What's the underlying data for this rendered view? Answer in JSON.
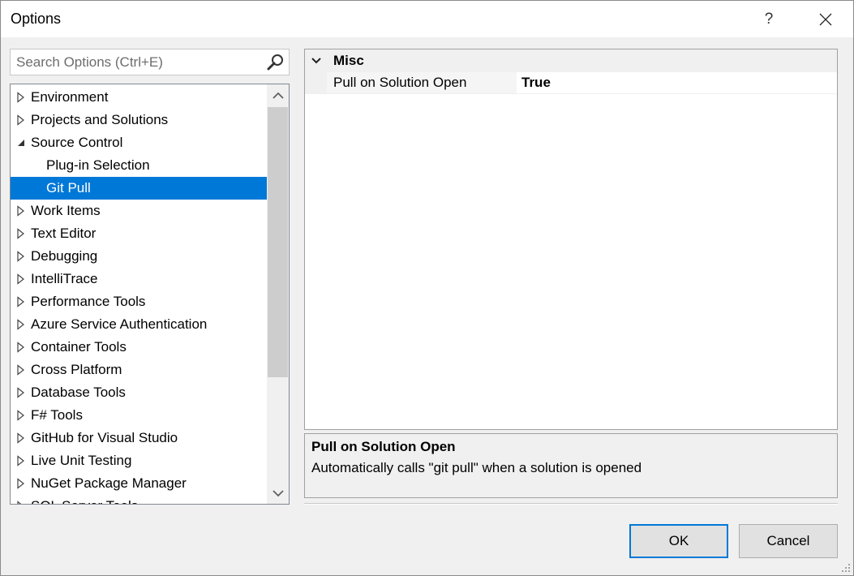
{
  "window": {
    "title": "Options",
    "help": "?"
  },
  "search": {
    "placeholder": "Search Options (Ctrl+E)"
  },
  "tree": {
    "items": [
      {
        "label": "Environment",
        "state": "collapsed",
        "level": 0
      },
      {
        "label": "Projects and Solutions",
        "state": "collapsed",
        "level": 0
      },
      {
        "label": "Source Control",
        "state": "expanded",
        "level": 0
      },
      {
        "label": "Plug-in Selection",
        "state": "leaf",
        "level": 1
      },
      {
        "label": "Git Pull",
        "state": "leaf",
        "level": 1,
        "selected": true
      },
      {
        "label": "Work Items",
        "state": "collapsed",
        "level": 0
      },
      {
        "label": "Text Editor",
        "state": "collapsed",
        "level": 0
      },
      {
        "label": "Debugging",
        "state": "collapsed",
        "level": 0
      },
      {
        "label": "IntelliTrace",
        "state": "collapsed",
        "level": 0
      },
      {
        "label": "Performance Tools",
        "state": "collapsed",
        "level": 0
      },
      {
        "label": "Azure Service Authentication",
        "state": "collapsed",
        "level": 0
      },
      {
        "label": "Container Tools",
        "state": "collapsed",
        "level": 0
      },
      {
        "label": "Cross Platform",
        "state": "collapsed",
        "level": 0
      },
      {
        "label": "Database Tools",
        "state": "collapsed",
        "level": 0
      },
      {
        "label": "F# Tools",
        "state": "collapsed",
        "level": 0
      },
      {
        "label": "GitHub for Visual Studio",
        "state": "collapsed",
        "level": 0
      },
      {
        "label": "Live Unit Testing",
        "state": "collapsed",
        "level": 0
      },
      {
        "label": "NuGet Package Manager",
        "state": "collapsed",
        "level": 0
      },
      {
        "label": "SQL Server Tools",
        "state": "collapsed",
        "level": 0
      }
    ]
  },
  "propgrid": {
    "category": "Misc",
    "property": {
      "name": "Pull on Solution Open",
      "value": "True"
    }
  },
  "description": {
    "title": "Pull on Solution Open",
    "text": "Automatically calls \"git pull\" when a solution is opened"
  },
  "buttons": {
    "ok": "OK",
    "cancel": "Cancel"
  },
  "colors": {
    "selection": "#0078d7",
    "background": "#f0f0f0"
  }
}
